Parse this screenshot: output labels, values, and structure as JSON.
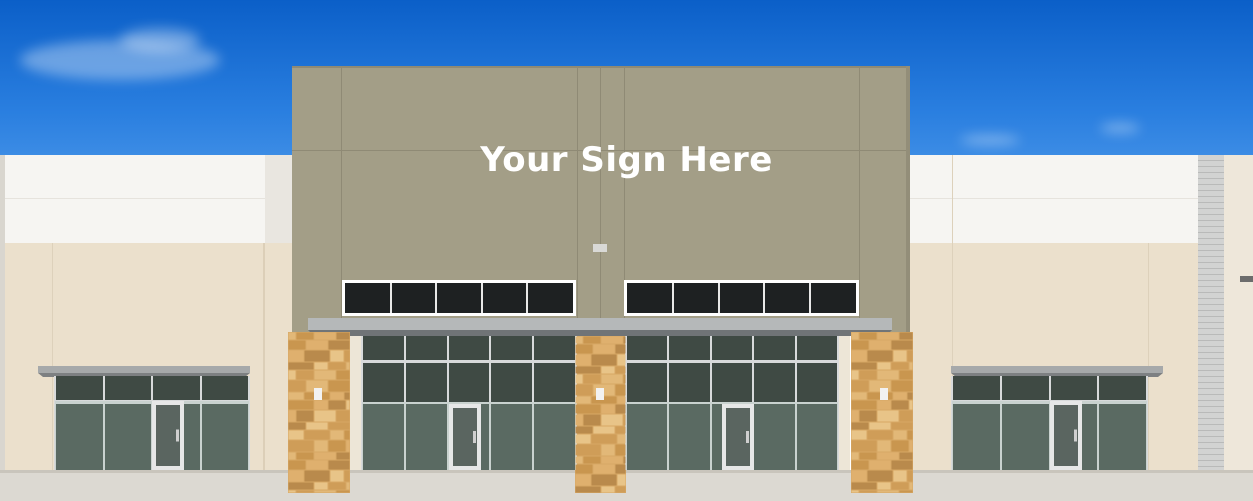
{
  "sign_text": "Your Sign Here",
  "colors": {
    "sky_top": "#0b5fc8",
    "tower": "#a39e87",
    "wing_upper": "#f6f5f2",
    "wing_lower": "#ebe0cc",
    "stone": "#d7a865",
    "glass": "#3f4a44",
    "ground": "#dcd9d2"
  }
}
